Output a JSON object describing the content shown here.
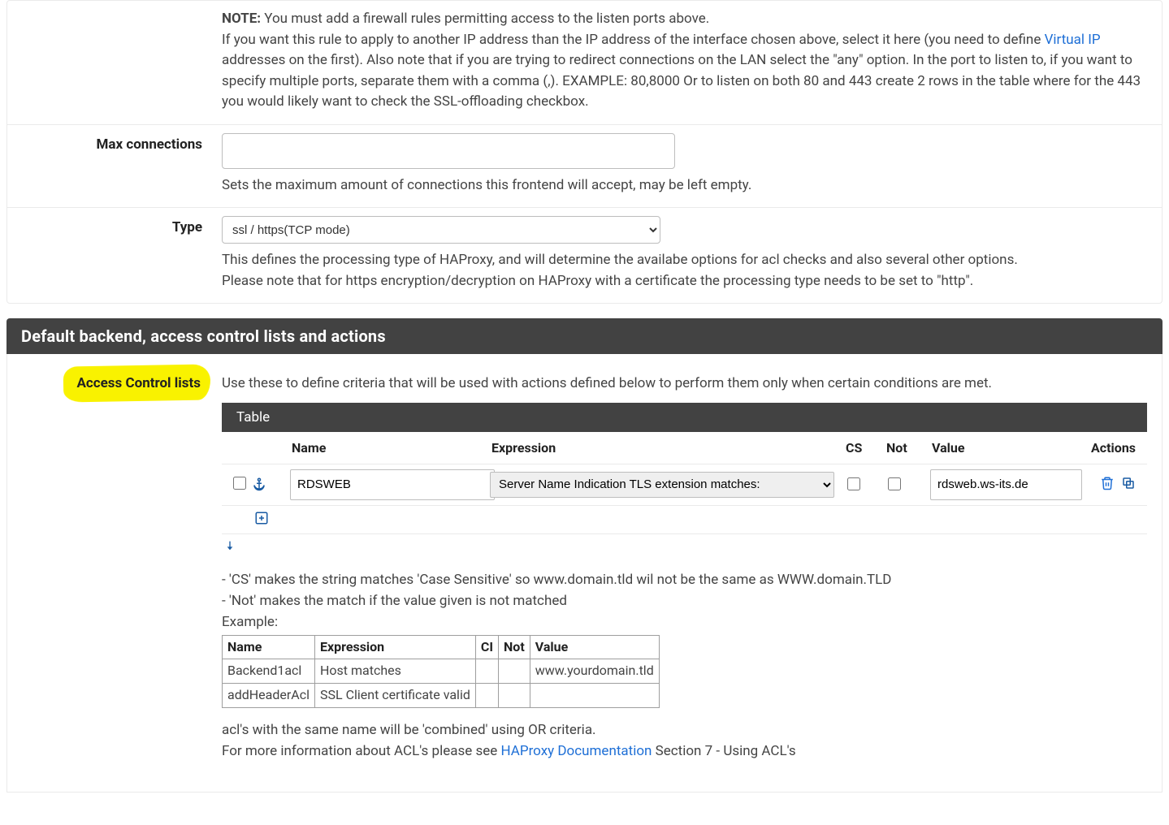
{
  "note": {
    "label": "NOTE:",
    "line0": "You must add a firewall rules permitting access to the listen ports above.",
    "line1a": "If you want this rule to apply to another IP address than the IP address of the interface chosen above, select it here (you need to define ",
    "vip_link": "Virtual IP",
    "line1b": " addresses on the first). Also note that if you are trying to redirect connections on the LAN select the \"any\" option. In the port to listen to, if you want to specify multiple ports, separate them with a comma (,). EXAMPLE: 80,8000 Or to listen on both 80 and 443 create 2 rows in the table where for the 443 you would likely want to check the SSL-offloading checkbox."
  },
  "maxconn": {
    "label": "Max connections",
    "value": "",
    "help": "Sets the maximum amount of connections this frontend will accept, may be left empty."
  },
  "type": {
    "label": "Type",
    "selected": "ssl / https(TCP mode)",
    "help1": "This defines the processing type of HAProxy, and will determine the availabe options for acl checks and also several other options.",
    "help2": "Please note that for https encryption/decryption on HAProxy with a certificate the processing type needs to be set to \"http\"."
  },
  "section_title": "Default backend, access control lists and actions",
  "acl": {
    "label": "Access Control lists",
    "intro": "Use these to define criteria that will be used with actions defined below to perform them only when certain conditions are met.",
    "table_title": "Table",
    "headers": {
      "name": "Name",
      "expression": "Expression",
      "cs": "CS",
      "not": "Not",
      "value": "Value",
      "actions": "Actions"
    },
    "row": {
      "name": "RDSWEB",
      "expression": "Server Name Indication TLS extension matches:",
      "value": "rdsweb.ws-its.de"
    },
    "notes": {
      "n1": "- 'CS' makes the string matches 'Case Sensitive' so www.domain.tld wil not be the same as WWW.domain.TLD",
      "n2": "- 'Not' makes the match if the value given is not matched",
      "ex_label": "Example:"
    },
    "example": {
      "h_name": "Name",
      "h_expr": "Expression",
      "h_ci": "CI",
      "h_not": "Not",
      "h_val": "Value",
      "r1_name": "Backend1acl",
      "r1_expr": "Host matches",
      "r1_val": "www.yourdomain.tld",
      "r2_name": "addHeaderAcl",
      "r2_expr": "SSL Client certificate valid"
    },
    "post1": "acl's with the same name will be 'combined' using OR criteria.",
    "post2a": "For more information about ACL's please see ",
    "post2_link": "HAProxy Documentation",
    "post2b": " Section 7 - Using ACL's"
  }
}
